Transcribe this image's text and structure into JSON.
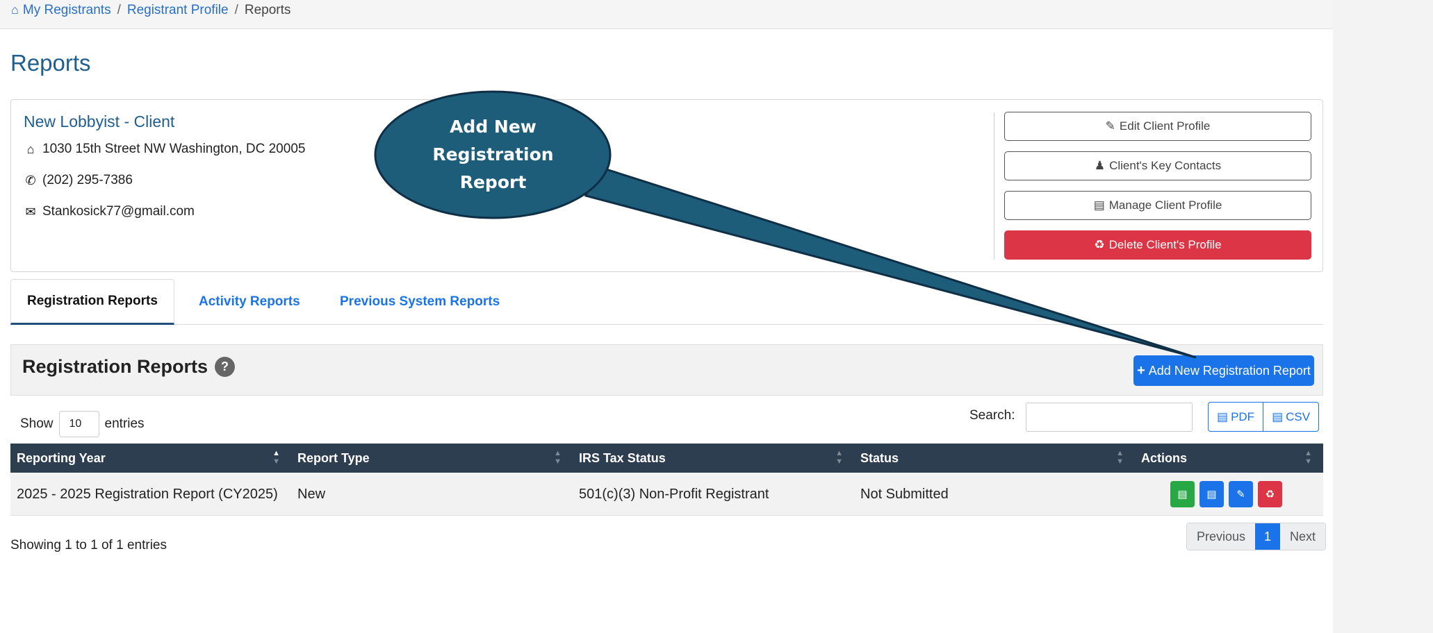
{
  "breadcrumb": {
    "items": [
      "My Registrants",
      "Registrant Profile",
      "Reports"
    ],
    "separator": "/"
  },
  "page_title": "Reports",
  "client": {
    "name": "New Lobbyist - Client",
    "address": "1030 15th Street NW Washington, DC 20005",
    "phone": "(202) 295-7386",
    "email": "Stankosick77@gmail.com",
    "buttons": {
      "edit": "Edit Client Profile",
      "contacts": "Client's Key Contacts",
      "manage": "Manage Client Profile",
      "delete": "Delete Client's Profile"
    }
  },
  "tabs": [
    {
      "label": "Registration Reports",
      "active": true
    },
    {
      "label": "Activity Reports",
      "active": false
    },
    {
      "label": "Previous System Reports",
      "active": false
    }
  ],
  "panel": {
    "title": "Registration Reports",
    "help": "?",
    "add_button": "Add New Registration Report"
  },
  "controls": {
    "show_label": "Show",
    "entries_value": "10",
    "entries_label": "entries",
    "search_label": "Search:",
    "search_value": "",
    "pdf_label": "PDF",
    "csv_label": "CSV"
  },
  "table": {
    "columns": [
      "Reporting Year",
      "Report Type",
      "IRS Tax Status",
      "Status",
      "Actions"
    ],
    "rows": [
      {
        "reporting_year": "2025 - 2025 Registration Report (CY2025)",
        "report_type": "New",
        "irs_tax_status": "501(c)(3) Non-Profit Registrant",
        "status": "Not Submitted",
        "actions": [
          "pdf-icon",
          "file-icon",
          "pencil-icon",
          "trash-icon"
        ]
      }
    ]
  },
  "footer": {
    "info": "Showing 1 to 1 of 1 entries",
    "pager": {
      "previous": "Previous",
      "current": "1",
      "next": "Next"
    }
  },
  "annotation": {
    "lines": [
      "Add New",
      "Registration",
      "Report"
    ],
    "fill_color": "#1d5d7a",
    "stroke_color": "#0f2f47"
  },
  "colors": {
    "primary": "#1a73e8",
    "danger": "#dc3545",
    "success": "#28a745",
    "table_header": "#2c3e50",
    "title": "#1f5e8f"
  }
}
